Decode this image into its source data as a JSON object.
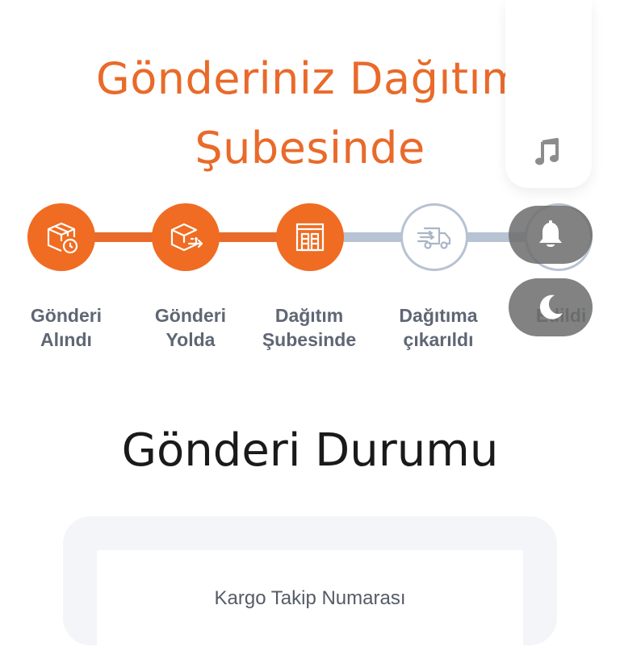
{
  "status": {
    "headline": "Gönderiniz Dağıtım Şubesinde"
  },
  "steps": [
    {
      "label": "Gönderi Alındı",
      "state": "completed",
      "icon": "package-timer-icon"
    },
    {
      "label": "Gönderi Yolda",
      "state": "completed",
      "icon": "package-transit-icon"
    },
    {
      "label": "Dağıtım Şubesinde",
      "state": "current",
      "icon": "warehouse-icon"
    },
    {
      "label": "Dağıtıma çıkarıldı",
      "state": "pending",
      "icon": "delivery-truck-icon"
    },
    {
      "label": "Edildi",
      "state": "pending",
      "icon": "delivered-icon"
    }
  ],
  "side_panel": {
    "icons": [
      "music-note-icon",
      "bell-icon",
      "moon-icon"
    ]
  },
  "section": {
    "title": "Gönderi Durumu"
  },
  "form": {
    "tracking_label": "Kargo Takip Numarası"
  },
  "colors": {
    "accent": "#ef6c22",
    "pending": "#b7c2d3",
    "overlay": "#6e6e6e"
  }
}
